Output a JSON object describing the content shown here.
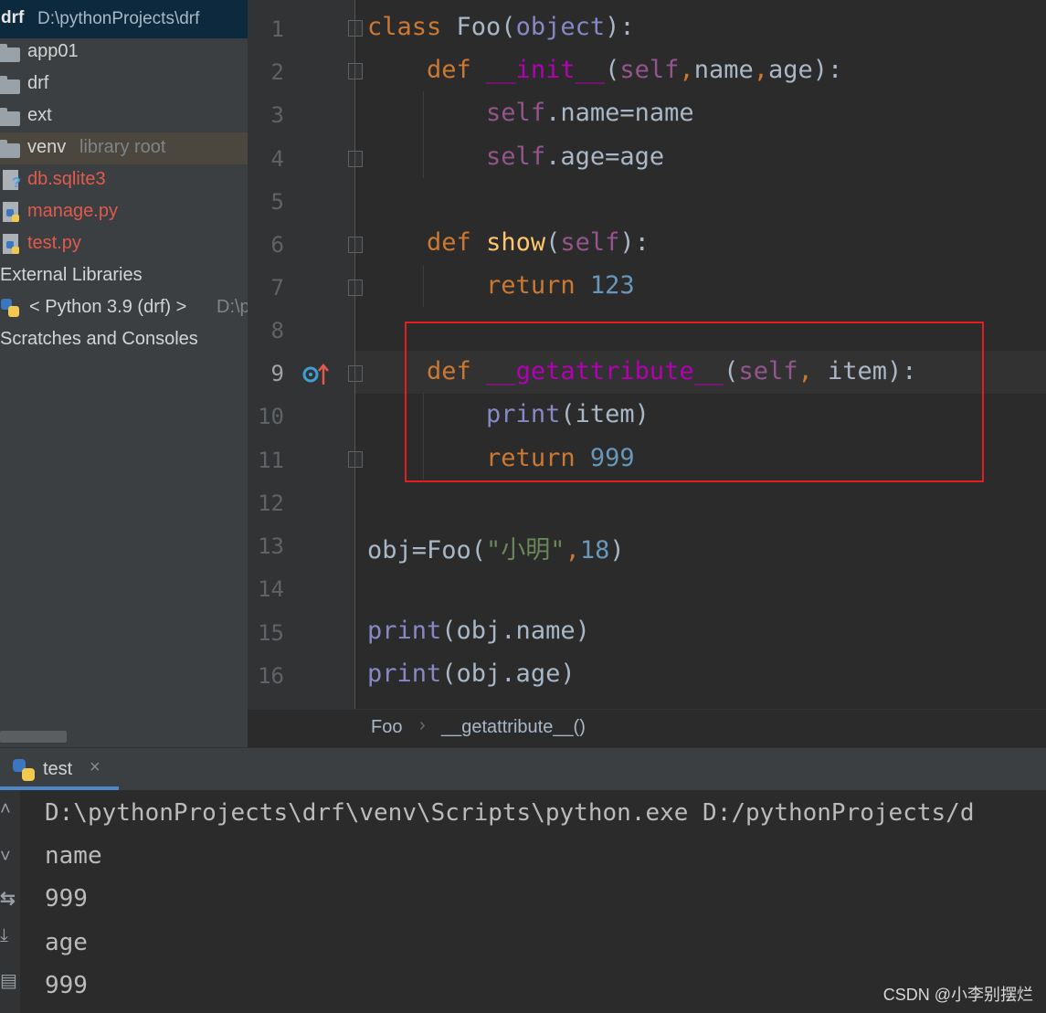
{
  "project": {
    "name": "drf",
    "path": "D:\\pythonProjects\\drf",
    "items": [
      {
        "label": "app01",
        "kind": "folder"
      },
      {
        "label": "drf",
        "kind": "folder"
      },
      {
        "label": "ext",
        "kind": "folder"
      },
      {
        "label": "venv",
        "kind": "folder",
        "note": "library root"
      },
      {
        "label": "db.sqlite3",
        "kind": "file"
      },
      {
        "label": "manage.py",
        "kind": "python-file"
      },
      {
        "label": "test.py",
        "kind": "python-file"
      },
      {
        "label": "External Libraries",
        "kind": "group"
      },
      {
        "label": "< Python 3.9 (drf) >",
        "kind": "sdk",
        "note": "D:\\p"
      },
      {
        "label": "Scratches and Consoles",
        "kind": "group"
      }
    ]
  },
  "editor": {
    "line_numbers": [
      "1",
      "2",
      "3",
      "4",
      "5",
      "6",
      "7",
      "8",
      "9",
      "10",
      "11",
      "12",
      "13",
      "14",
      "15",
      "16"
    ],
    "lines": [
      "class Foo(object):",
      "    def __init__(self,name,age):",
      "        self.name=name",
      "        self.age=age",
      "",
      "    def show(self):",
      "        return 123",
      "",
      "    def __getattribute__(self, item):",
      "        print(item)",
      "        return 999",
      "",
      "obj=Foo(\"小明\",18)",
      "",
      "print(obj.name)",
      "print(obj.age)"
    ],
    "breadcrumb": [
      "Foo",
      "__getattribute__()"
    ],
    "breadcrumb_sep": "›",
    "highlight_color": "#e02020"
  },
  "run": {
    "tab_label": "test",
    "tab_close": "×",
    "output": [
      "D:\\pythonProjects\\drf\\venv\\Scripts\\python.exe D:/pythonProjects/d",
      "name",
      "999",
      "age",
      "999"
    ]
  },
  "watermark": "CSDN @小李别摆烂"
}
